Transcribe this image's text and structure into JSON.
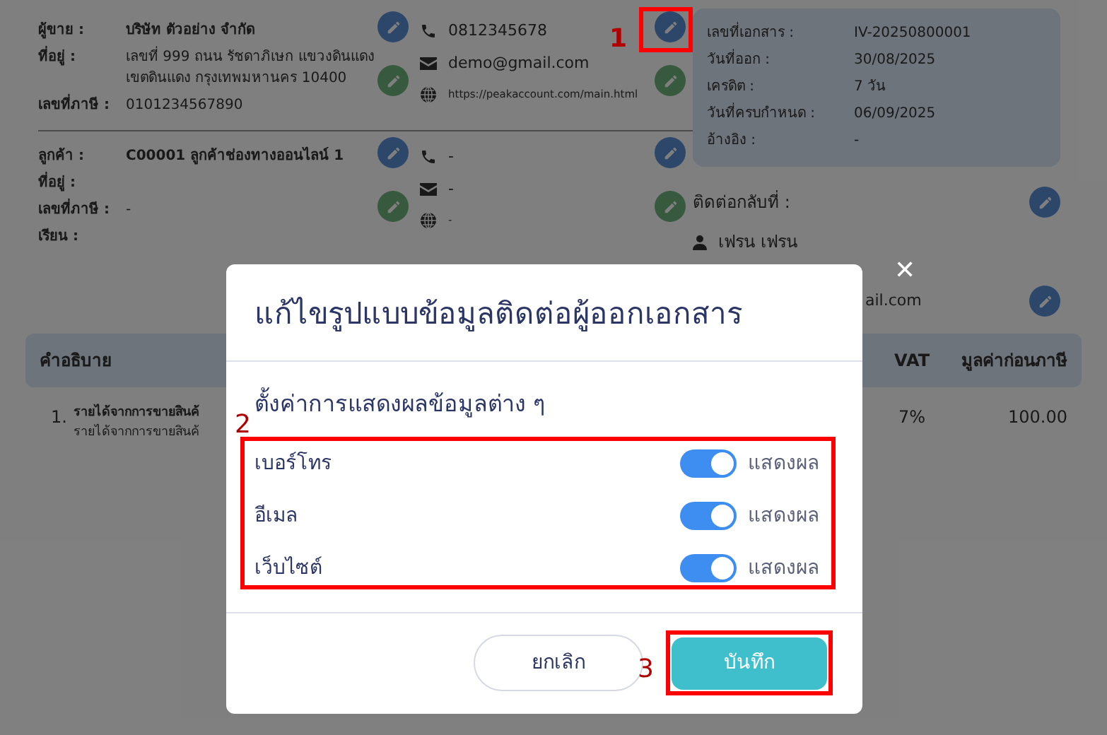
{
  "seller": {
    "fields": [
      {
        "label": "ผู้ขาย :",
        "value": "บริษัท ตัวอย่าง จำกัด"
      },
      {
        "label": "ที่อยู่ :",
        "value": "เลขที่ 999 ถนน รัชดาภิเษก แขวงดินแดง เขตดินแดง กรุงเทพมหานคร 10400"
      },
      {
        "label": "เลขที่ภาษี :",
        "value": "0101234567890"
      }
    ],
    "contacts": [
      {
        "kind": "phone",
        "text": "0812345678"
      },
      {
        "kind": "email",
        "text": "demo@gmail.com"
      },
      {
        "kind": "web",
        "text": "https://peakaccount.com/main.html"
      }
    ]
  },
  "customer": {
    "fields": [
      {
        "label": "ลูกค้า :",
        "value": "C00001 ลูกค้าช่องทางออนไลน์ 1"
      },
      {
        "label": "ที่อยู่ :"
      },
      {
        "label": "เลขที่ภาษี :",
        "value": "-"
      },
      {
        "label": "เรียน :"
      }
    ],
    "contacts": [
      {
        "kind": "phone",
        "text": "-"
      },
      {
        "kind": "email",
        "text": "-"
      },
      {
        "kind": "web",
        "text": "-"
      }
    ]
  },
  "document": {
    "fields": [
      {
        "label": "เลขที่เอกสาร :",
        "value": "IV-20250800001"
      },
      {
        "label": "วันที่ออก :",
        "value": "30/08/2025"
      },
      {
        "label": "เครดิต :",
        "value": "7 วัน"
      },
      {
        "label": "วันที่ครบกำหนด :",
        "value": "06/09/2025"
      },
      {
        "label": "อ้างอิง :",
        "value": "-"
      }
    ]
  },
  "contact_back": {
    "label": "ติดต่อกลับที่ :",
    "person": "เฟรน เฟรน",
    "email": "ail.com"
  },
  "table": {
    "columns": [
      "คำอธิบาย",
      "VAT",
      "มูลค่าก่อนภาษี"
    ],
    "rows": [
      {
        "index": "1.",
        "title": "รายได้จากการขายสินค้",
        "subtitle": "รายได้จากการขายสินค้",
        "vat": "7%",
        "amount": "100.00"
      }
    ]
  },
  "modal": {
    "title": "แก้ไขรูปแบบข้อมูลติดต่อผู้ออกเอกสาร",
    "section": "ตั้งค่าการแสดงผลข้อมูลต่าง ๆ",
    "rows": [
      {
        "label": "เบอร์โทร",
        "on": true,
        "state_text": "แสดงผล"
      },
      {
        "label": "อีเมล",
        "on": true,
        "state_text": "แสดงผล"
      },
      {
        "label": "เว็บไซต์",
        "on": true,
        "state_text": "แสดงผล"
      }
    ],
    "buttons": [
      {
        "kind": "cancel",
        "label": "ยกเลิก"
      },
      {
        "kind": "save",
        "label": "บันทึก"
      }
    ],
    "close": "✕"
  },
  "annotations": [
    "1",
    "2",
    "3"
  ]
}
